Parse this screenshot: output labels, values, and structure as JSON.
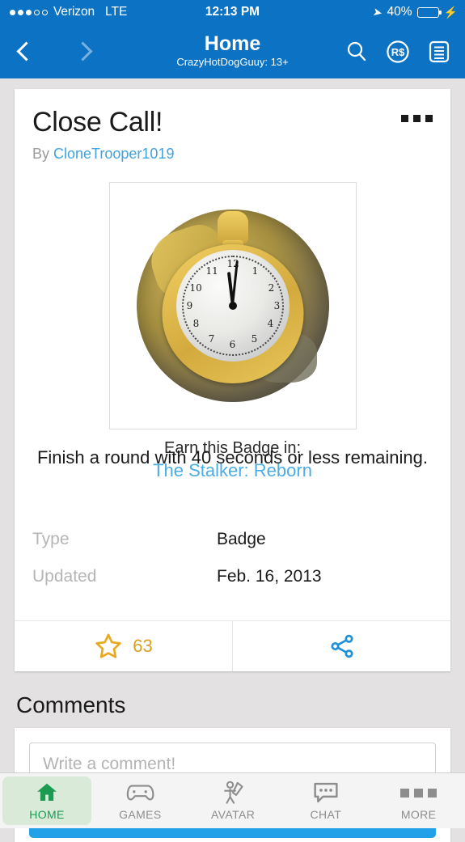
{
  "status_bar": {
    "signal_dots_filled": 3,
    "signal_dots_total": 5,
    "carrier": "Verizon",
    "network": "LTE",
    "time": "12:13 PM",
    "battery_percent": "40%",
    "battery_level": 40,
    "charging": true
  },
  "nav": {
    "title": "Home",
    "subtitle": "CrazyHotDogGuuy: 13+",
    "back_icon": "chevron-left-icon",
    "forward_icon": "chevron-right-icon",
    "search_icon": "search-icon",
    "robux_icon": "robux-icon",
    "robux_label": "R$",
    "menu_icon": "list-menu-icon"
  },
  "badge": {
    "title": "Close Call!",
    "by_prefix": "By",
    "author": "CloneTrooper1019",
    "overflow_icon": "more-options-icon",
    "image_alt": "gold-pocket-watch-badge",
    "earn_label": "Earn this Badge in:",
    "earn_game": "The Stalker: Reborn",
    "description": "Finish a round with 40 seconds or less remaining.",
    "details": [
      {
        "label": "Type",
        "value": "Badge"
      },
      {
        "label": "Updated",
        "value": "Feb. 16, 2013"
      }
    ],
    "favorite_count": "63",
    "favorite_icon": "star-icon",
    "share_icon": "share-icon"
  },
  "comments": {
    "heading": "Comments",
    "input_placeholder": "Write a comment!",
    "input_value": "",
    "post_label": ""
  },
  "tabbar": {
    "items": [
      {
        "label": "HOME",
        "icon": "home-icon",
        "active": true
      },
      {
        "label": "GAMES",
        "icon": "gamepad-icon",
        "active": false
      },
      {
        "label": "AVATAR",
        "icon": "avatar-icon",
        "active": false
      },
      {
        "label": "CHAT",
        "icon": "chat-icon",
        "active": false
      },
      {
        "label": "MORE",
        "icon": "more-dots-icon",
        "active": false
      }
    ]
  },
  "colors": {
    "header_blue": "#0b72c4",
    "link_blue": "#3ea3e0",
    "accent_blue": "#22a0e8",
    "gold": "#e8a91e",
    "green": "#1a9b4f",
    "page_bg": "#e3e1e1"
  }
}
